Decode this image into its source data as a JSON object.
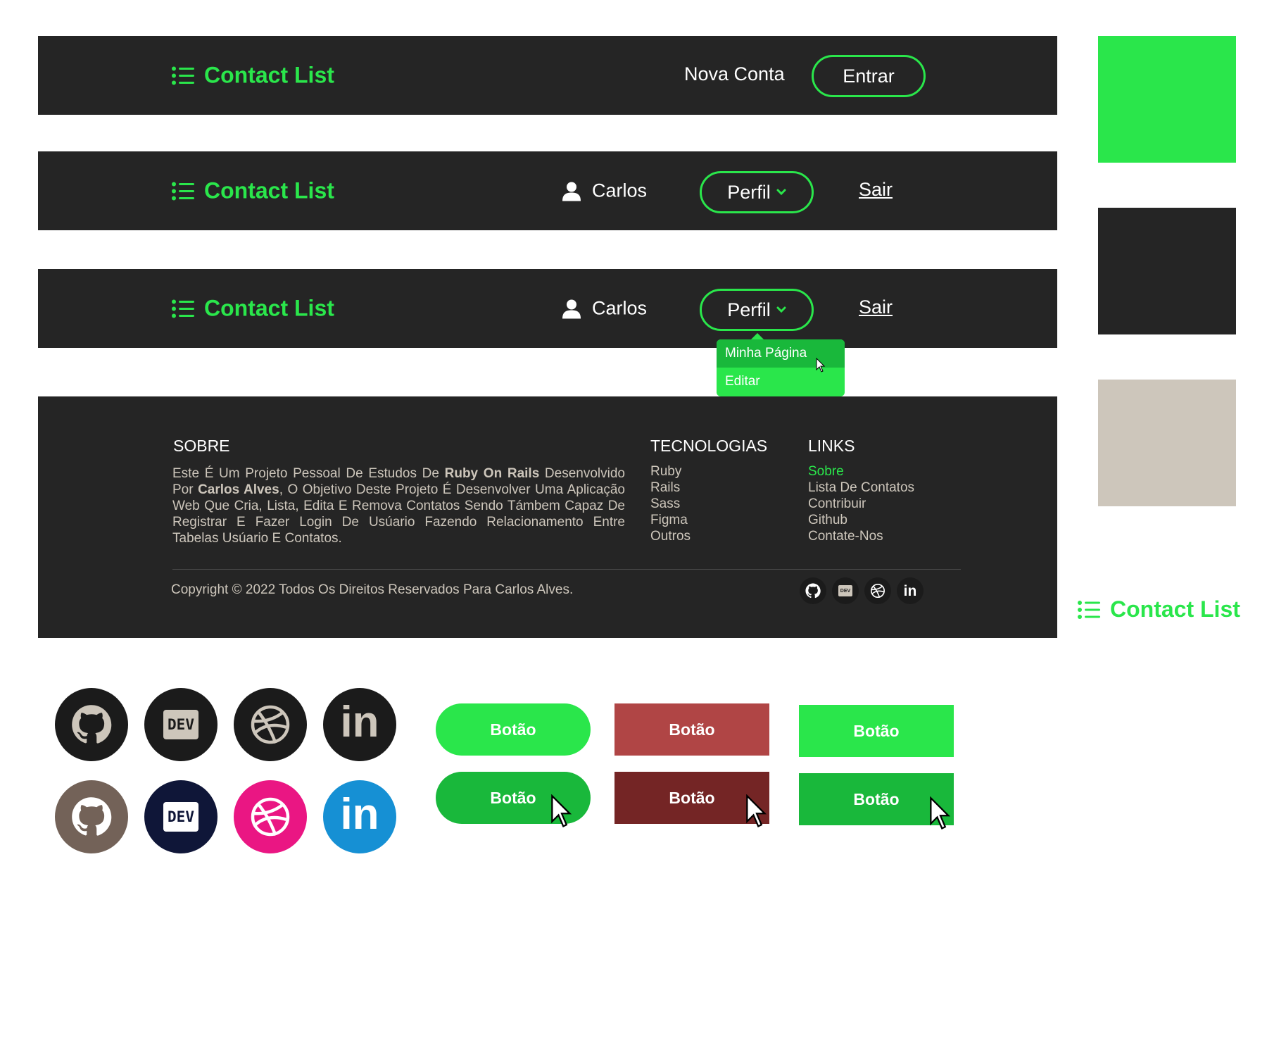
{
  "brand": {
    "name": "Contact List"
  },
  "header_guest": {
    "new_account": "Nova Conta",
    "login": "Entrar"
  },
  "header_user": {
    "user_name": "Carlos",
    "profile": "Perfil",
    "logout": "Sair"
  },
  "dropdown": {
    "items": [
      "Minha Página",
      "Editar"
    ]
  },
  "footer": {
    "about_title": "SOBRE",
    "about_parts": [
      "Este É Um Projeto Pessoal De Estudos De ",
      "Ruby On Rails",
      " Desenvolvido Por ",
      "Carlos Alves",
      ", O Objetivo Deste Projeto É Desenvolver Uma Aplicação Web Que Cria, Lista, Edita E Remova Contatos Sendo Támbem Capaz De Registrar E Fazer Login De Usúario Fazendo Relacionamento Entre Tabelas Usúario E Contatos."
    ],
    "tech_title": "TECNOLOGIAS",
    "tech_items": [
      "Ruby",
      "Rails",
      "Sass",
      "Figma",
      "Outros"
    ],
    "links_title": "LINKS",
    "links_items": [
      "Sobre",
      "Lista De Contatos",
      "Contribuir",
      "Github",
      "Contate-Nos"
    ],
    "copyright": "Copyright © 2022 Todos Os Direitos Reservados Para Carlos Alves."
  },
  "social_icons": [
    "github-icon",
    "dev-icon",
    "dribbble-icon",
    "linkedin-icon"
  ],
  "dev_label": "DEV",
  "linkedin_label": "in",
  "buttons": {
    "label": "Botão"
  },
  "colors": {
    "brand_green": "#2ae64b",
    "dark": "#252525",
    "beige": "#cdc6bb",
    "green_hover": "#19b83b",
    "red": "#b04545",
    "red_hover": "#742525",
    "github_brand": "#736258",
    "dev_brand": "#0f1638",
    "dribbble_brand": "#ea1683",
    "linkedin_brand": "#1690d4"
  }
}
